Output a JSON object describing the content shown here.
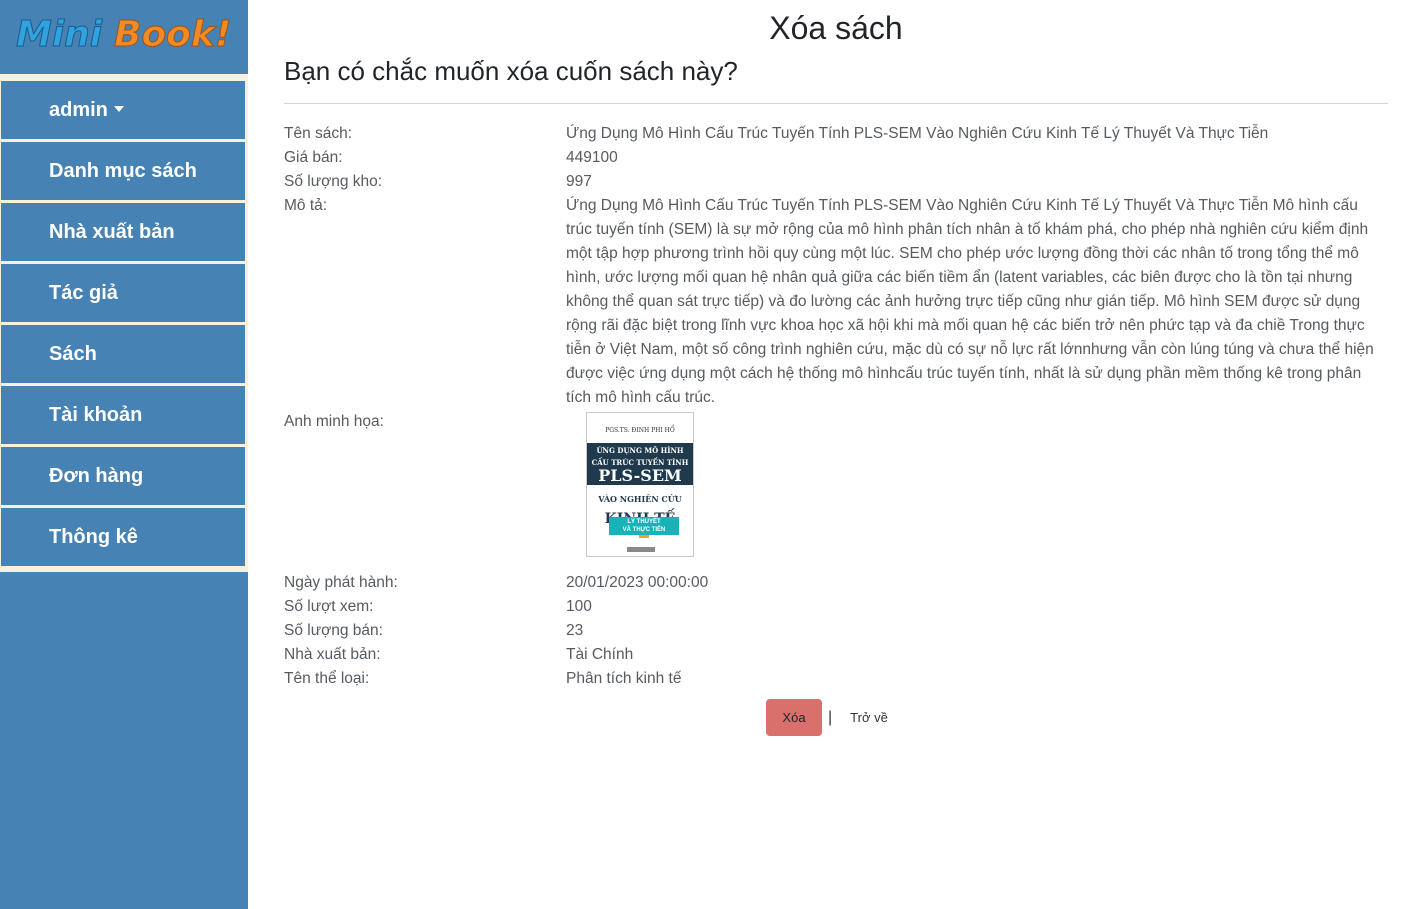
{
  "app": {
    "logo_text": "MiniBook!"
  },
  "sidebar": {
    "items": [
      {
        "label": "admin",
        "has_caret": true
      },
      {
        "label": "Danh mục sách"
      },
      {
        "label": "Nhà xuất bản"
      },
      {
        "label": "Tác giả"
      },
      {
        "label": "Sách"
      },
      {
        "label": "Tài khoản"
      },
      {
        "label": "Đơn hàng"
      },
      {
        "label": "Thông kê"
      }
    ]
  },
  "page": {
    "title": "Xóa sách",
    "subtitle": "Bạn có chắc muốn xóa cuốn sách này?"
  },
  "book": {
    "title_label": "Tên sách:",
    "title": "Ứng Dụng Mô Hình Cấu Trúc Tuyến Tính PLS-SEM Vào Nghiên Cứu Kinh Tế Lý Thuyết Và Thực Tiễn",
    "price_label": "Giá bán:",
    "price": "449100",
    "stock_label": "Số lượng kho:",
    "stock": "997",
    "description_label": "Mô tả:",
    "description": "Ứng Dụng Mô Hình Cấu Trúc Tuyến Tính PLS-SEM Vào Nghiên Cứu Kinh Tế Lý Thuyết Và Thực Tiễn Mô hình cấu trúc tuyến tính (SEM) là sự mở rộng của mô hình phân tích nhân à tố khám phá, cho phép nhà nghiên cứu kiểm định một tập hợp phương trình hồi quy cùng một lúc. SEM cho phép ước lượng đồng thời các nhân tố trong tổng thể mô hình, ước lượng mối quan hệ nhân quả giữa các biến tiềm ẩn (latent variables, các biên được cho là tồn tại nhưng không thể quan sát trực tiếp) và đo lường các ảnh hưởng trực tiếp cũng như gián tiếp. Mô hình SEM được sử dụng rộng rãi đặc biệt trong lĩnh vực khoa học xã hội khi mà mối quan hệ các biến trở nên phức tạp và đa chiề Trong thực tiễn ở Việt Nam, một số công trình nghiên cứu, mặc dù có sự nỗ lực rất lớnnhưng vẫn còn lúng túng và chưa thể hiện được việc ứng dụng một cách hệ thống mô hìnhcấu trúc tuyến tính, nhất là sử dụng phần mềm thống kê trong phân tích mô hình cấu trúc.",
    "image_label": "Anh minh họa:",
    "cover": {
      "author": "PGS.TS. ĐINH PHI HỔ",
      "line1": "ỨNG DỤNG MÔ HÌNH",
      "line2": "CẤU TRÚC TUYẾN TÍNH",
      "line3": "PLS-SEM",
      "line4": "VÀO NGHIÊN CỨU",
      "line5": "KINH TẾ",
      "line6": "LÝ THUYẾT",
      "line7": "VÀ THỰC TIỄN"
    },
    "release_label": "Ngày phát hành:",
    "release": "20/01/2023 00:00:00",
    "views_label": "Số lượt xem:",
    "views": "100",
    "sold_label": "Số lượng bán:",
    "sold": "23",
    "publisher_label": "Nhà xuất bản:",
    "publisher": "Tài Chính",
    "category_label": "Tên thể loại:",
    "category": "Phân tích kinh tế"
  },
  "actions": {
    "delete_label": "Xóa",
    "separator": "|",
    "back_label": "Trở về"
  },
  "colors": {
    "sidebar_bg": "#4682b4",
    "nav_border": "#fbf0dc",
    "delete_button": "#d9706c"
  }
}
